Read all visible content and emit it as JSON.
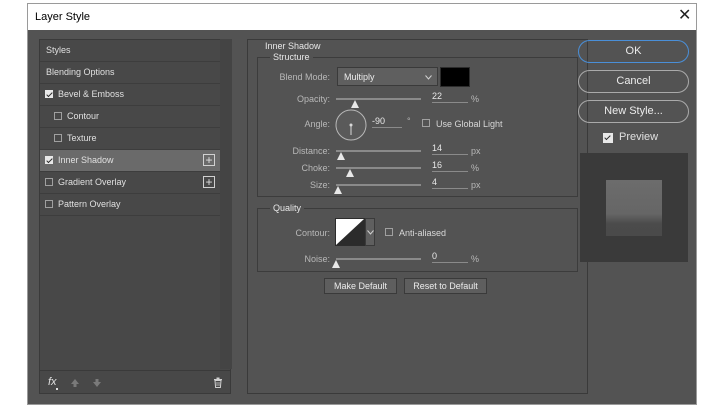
{
  "window": {
    "title": "Layer Style",
    "close_glyph": "✕"
  },
  "styles_list": [
    {
      "label": "Styles",
      "checkbox": false,
      "checked": false,
      "indent": false,
      "plus": false,
      "selected": false
    },
    {
      "label": "Blending Options",
      "checkbox": false,
      "checked": false,
      "indent": false,
      "plus": false,
      "selected": false
    },
    {
      "label": "Bevel & Emboss",
      "checkbox": true,
      "checked": true,
      "indent": false,
      "plus": false,
      "selected": false
    },
    {
      "label": "Contour",
      "checkbox": true,
      "checked": false,
      "indent": true,
      "plus": false,
      "selected": false
    },
    {
      "label": "Texture",
      "checkbox": true,
      "checked": false,
      "indent": true,
      "plus": false,
      "selected": false
    },
    {
      "label": "Inner Shadow",
      "checkbox": true,
      "checked": true,
      "indent": false,
      "plus": true,
      "selected": true
    },
    {
      "label": "Gradient Overlay",
      "checkbox": true,
      "checked": false,
      "indent": false,
      "plus": true,
      "selected": false
    },
    {
      "label": "Pattern Overlay",
      "checkbox": true,
      "checked": false,
      "indent": false,
      "plus": false,
      "selected": false
    }
  ],
  "left_footer": {
    "fx_label": "fx",
    "up_icon": "arrow-up-icon",
    "down_icon": "arrow-down-icon",
    "trash_icon": "trash-icon"
  },
  "inner_shadow": {
    "title": "Inner Shadow",
    "structure": {
      "title": "Structure",
      "blend_mode_label": "Blend Mode:",
      "blend_mode_value": "Multiply",
      "shadow_color": "#000000",
      "opacity_label": "Opacity:",
      "opacity_value": "22",
      "opacity_unit": "%",
      "opacity_fraction": 0.22,
      "angle_label": "Angle:",
      "angle_value": "-90",
      "angle_unit": "°",
      "use_global_light_label": "Use Global Light",
      "use_global_light": false,
      "distance_label": "Distance:",
      "distance_value": "14",
      "distance_unit": "px",
      "distance_fraction": 0.06,
      "choke_label": "Choke:",
      "choke_value": "16",
      "choke_unit": "%",
      "choke_fraction": 0.16,
      "size_label": "Size:",
      "size_value": "4",
      "size_unit": "px",
      "size_fraction": 0.02
    },
    "quality": {
      "title": "Quality",
      "contour_label": "Contour:",
      "anti_aliased_label": "Anti-aliased",
      "anti_aliased": false,
      "noise_label": "Noise:",
      "noise_value": "0",
      "noise_unit": "%",
      "noise_fraction": 0.0
    },
    "make_default_label": "Make Default",
    "reset_default_label": "Reset to Default"
  },
  "actions": {
    "ok_label": "OK",
    "cancel_label": "Cancel",
    "new_style_label": "New Style...",
    "preview_label": "Preview",
    "preview_checked": true
  }
}
